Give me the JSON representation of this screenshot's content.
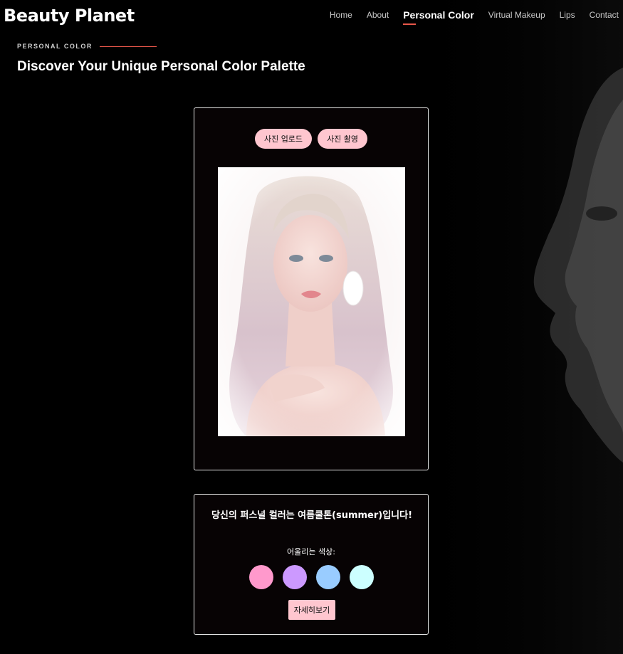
{
  "header": {
    "logo": "Beauty Planet",
    "nav": [
      {
        "label": "Home",
        "active": false
      },
      {
        "label": "About",
        "active": false
      },
      {
        "label": "Personal Color",
        "active": true
      },
      {
        "label": "Virtual Makeup",
        "active": false
      },
      {
        "label": "Lips",
        "active": false
      },
      {
        "label": "Contact",
        "active": false
      }
    ]
  },
  "section": {
    "eyebrow": "PERSONAL COLOR",
    "title": "Discover Your Unique Personal Color Palette"
  },
  "upload": {
    "upload_label": "사진 업로드",
    "capture_label": "사진 촬영"
  },
  "result": {
    "title": "당신의 퍼스널 컬러는 여름쿨톤(summer)입니다!",
    "subtitle": "어울리는 색상:",
    "swatches": [
      "#ff99cc",
      "#cc99ff",
      "#99ccff",
      "#ccffff"
    ],
    "detail_label": "자세히보기"
  },
  "colors": {
    "accent": "#e8574a",
    "pill": "#ffc6cf"
  }
}
